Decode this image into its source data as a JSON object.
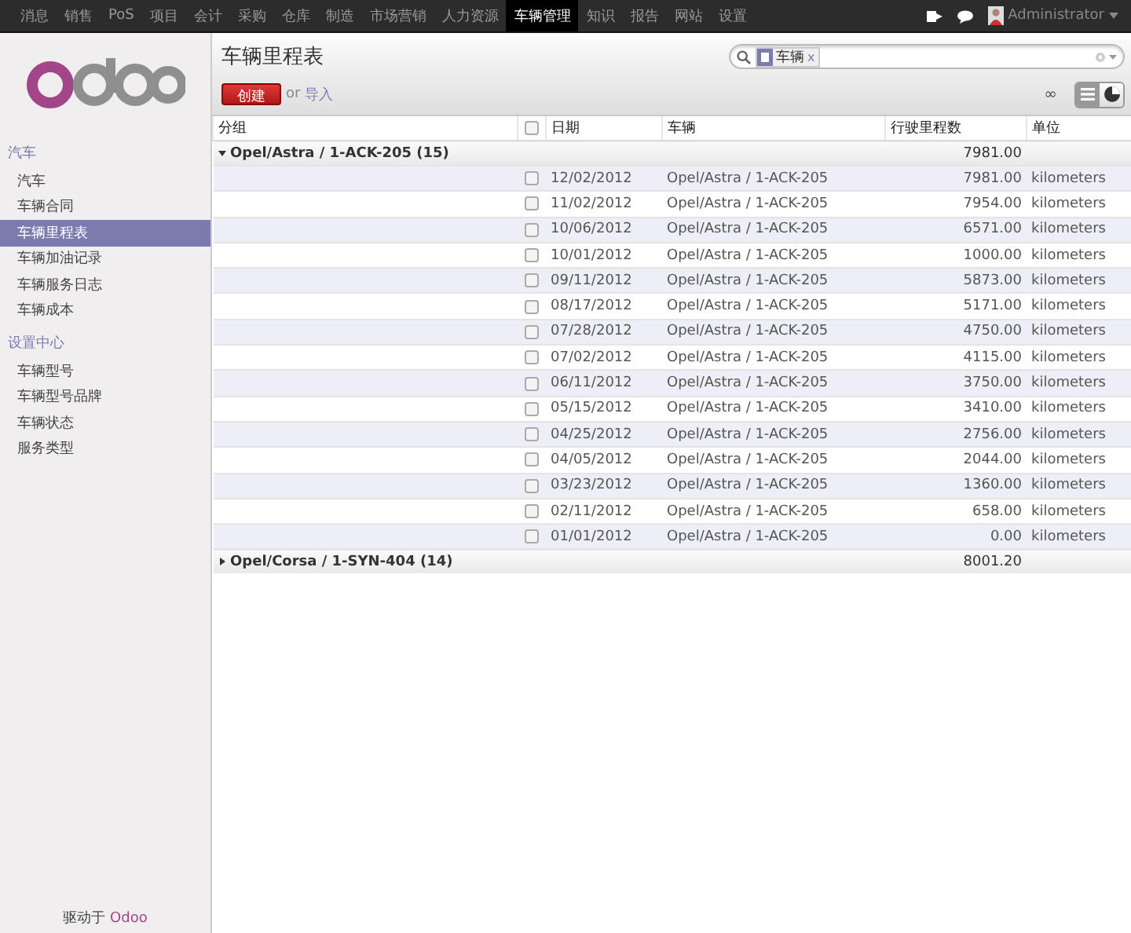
{
  "top_menu": [
    {
      "label": "消息",
      "selected": false
    },
    {
      "label": "销售",
      "selected": false
    },
    {
      "label": "PoS",
      "selected": false
    },
    {
      "label": "项目",
      "selected": false
    },
    {
      "label": "会计",
      "selected": false
    },
    {
      "label": "采购",
      "selected": false
    },
    {
      "label": "仓库",
      "selected": false
    },
    {
      "label": "制造",
      "selected": false
    },
    {
      "label": "市场营销",
      "selected": false
    },
    {
      "label": "人力资源",
      "selected": false
    },
    {
      "label": "车辆管理",
      "selected": true
    },
    {
      "label": "知识",
      "selected": false
    },
    {
      "label": "报告",
      "selected": false
    },
    {
      "label": "网站",
      "selected": false
    },
    {
      "label": "设置",
      "selected": false
    }
  ],
  "user": {
    "name": "Administrator"
  },
  "sidebar": {
    "sections": [
      {
        "title": "汽车",
        "items": [
          {
            "label": "汽车",
            "selected": false
          },
          {
            "label": "车辆合同",
            "selected": false
          },
          {
            "label": "车辆里程表",
            "selected": true
          },
          {
            "label": "车辆加油记录",
            "selected": false
          },
          {
            "label": "车辆服务日志",
            "selected": false
          },
          {
            "label": "车辆成本",
            "selected": false
          }
        ]
      },
      {
        "title": "设置中心",
        "items": [
          {
            "label": "车辆型号",
            "selected": false
          },
          {
            "label": "车辆型号品牌",
            "selected": false
          },
          {
            "label": "车辆状态",
            "selected": false
          },
          {
            "label": "服务类型",
            "selected": false
          }
        ]
      }
    ],
    "footer_prefix": "驱动于",
    "footer_brand": "Odoo"
  },
  "title": "车辆里程表",
  "search": {
    "facets": [
      {
        "label": "车辆",
        "remove": "x"
      }
    ]
  },
  "create_button": "创建",
  "or_text": "or",
  "import_link": "导入",
  "pager": "∞",
  "views": [
    {
      "kind": "list",
      "selected": true
    },
    {
      "kind": "graph",
      "selected": false
    }
  ],
  "table": {
    "columns": [
      "分组",
      "日期",
      "车辆",
      "行驶里程数",
      "单位"
    ],
    "select_all_checked": false,
    "groups": [
      {
        "label": "Opel/Astra / 1-ACK-205 (15)",
        "expanded": true,
        "total": "7981.00",
        "rows": [
          {
            "date": "12/02/2012",
            "vehicle": "Opel/Astra / 1-ACK-205",
            "value": "7981.00",
            "unit": "kilometers",
            "checked": false
          },
          {
            "date": "11/02/2012",
            "vehicle": "Opel/Astra / 1-ACK-205",
            "value": "7954.00",
            "unit": "kilometers",
            "checked": false
          },
          {
            "date": "10/06/2012",
            "vehicle": "Opel/Astra / 1-ACK-205",
            "value": "6571.00",
            "unit": "kilometers",
            "checked": false
          },
          {
            "date": "10/01/2012",
            "vehicle": "Opel/Astra / 1-ACK-205",
            "value": "1000.00",
            "unit": "kilometers",
            "checked": false
          },
          {
            "date": "09/11/2012",
            "vehicle": "Opel/Astra / 1-ACK-205",
            "value": "5873.00",
            "unit": "kilometers",
            "checked": false
          },
          {
            "date": "08/17/2012",
            "vehicle": "Opel/Astra / 1-ACK-205",
            "value": "5171.00",
            "unit": "kilometers",
            "checked": false
          },
          {
            "date": "07/28/2012",
            "vehicle": "Opel/Astra / 1-ACK-205",
            "value": "4750.00",
            "unit": "kilometers",
            "checked": false
          },
          {
            "date": "07/02/2012",
            "vehicle": "Opel/Astra / 1-ACK-205",
            "value": "4115.00",
            "unit": "kilometers",
            "checked": false
          },
          {
            "date": "06/11/2012",
            "vehicle": "Opel/Astra / 1-ACK-205",
            "value": "3750.00",
            "unit": "kilometers",
            "checked": false
          },
          {
            "date": "05/15/2012",
            "vehicle": "Opel/Astra / 1-ACK-205",
            "value": "3410.00",
            "unit": "kilometers",
            "checked": false
          },
          {
            "date": "04/25/2012",
            "vehicle": "Opel/Astra / 1-ACK-205",
            "value": "2756.00",
            "unit": "kilometers",
            "checked": false
          },
          {
            "date": "04/05/2012",
            "vehicle": "Opel/Astra / 1-ACK-205",
            "value": "2044.00",
            "unit": "kilometers",
            "checked": false
          },
          {
            "date": "03/23/2012",
            "vehicle": "Opel/Astra / 1-ACK-205",
            "value": "1360.00",
            "unit": "kilometers",
            "checked": false
          },
          {
            "date": "02/11/2012",
            "vehicle": "Opel/Astra / 1-ACK-205",
            "value": "658.00",
            "unit": "kilometers",
            "checked": false
          },
          {
            "date": "01/01/2012",
            "vehicle": "Opel/Astra / 1-ACK-205",
            "value": "0.00",
            "unit": "kilometers",
            "checked": false
          }
        ]
      },
      {
        "label": "Opel/Corsa / 1-SYN-404 (14)",
        "expanded": false,
        "total": "8001.20"
      }
    ]
  }
}
